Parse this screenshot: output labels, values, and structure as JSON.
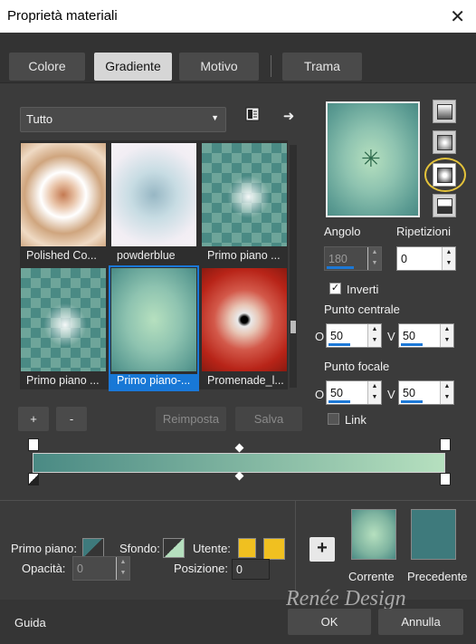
{
  "window": {
    "title": "Proprietà materiali",
    "close_glyph": "✕"
  },
  "tabs": [
    {
      "label": "Colore"
    },
    {
      "label": "Gradiente",
      "active": true
    },
    {
      "label": "Motivo"
    },
    {
      "label": "Trama"
    }
  ],
  "filter": {
    "selected": "Tutto"
  },
  "thumbnails": [
    {
      "label": "Polished Co..."
    },
    {
      "label": "powderblue"
    },
    {
      "label": "Primo piano ..."
    },
    {
      "label": "Primo piano ..."
    },
    {
      "label": "Primo piano-...",
      "selected": true
    },
    {
      "label": "Promenade_l..."
    }
  ],
  "list_buttons": {
    "add": "+",
    "remove": "-",
    "reset": "Reimposta",
    "save": "Salva"
  },
  "settings": {
    "angle_label": "Angolo",
    "angle_value": "180",
    "repeat_label": "Ripetizioni",
    "repeat_value": "0",
    "invert_label": "Inverti",
    "invert_checked": true,
    "center_label": "Punto centrale",
    "center_o": "50",
    "center_v": "50",
    "focal_label": "Punto focale",
    "focal_o": "50",
    "focal_v": "50",
    "link_label": "Link",
    "link_checked": false,
    "o_label": "O",
    "v_label": "V"
  },
  "footer": {
    "fg_label": "Primo piano:",
    "bg_label": "Sfondo:",
    "user_label": "Utente:",
    "opacity_label": "Opacità:",
    "opacity_value": "0",
    "position_label": "Posizione:",
    "position_value": "0",
    "current_label": "Corrente",
    "previous_label": "Precedente",
    "add_glyph": "+"
  },
  "bottom": {
    "help_label": "Guida",
    "ok_label": "OK",
    "cancel_label": "Annulla",
    "watermark": "Renée Design"
  },
  "colors": {
    "teal_dark": "#3e7a7c",
    "mint_light": "#b6e0bf",
    "user_yellow": "#f0c020",
    "accent_blue": "#1878d6",
    "highlight_ring": "#e3c23a"
  }
}
